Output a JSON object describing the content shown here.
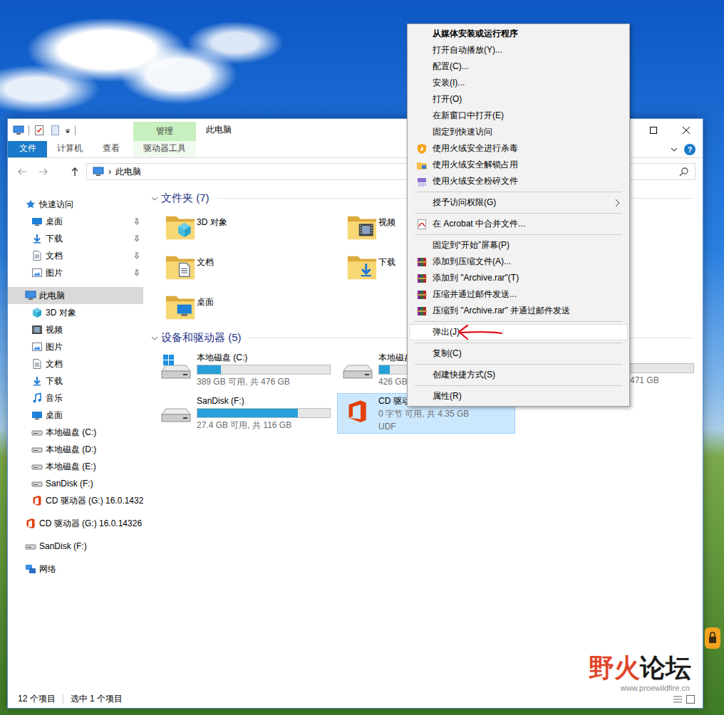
{
  "window": {
    "title": "此电脑",
    "context_tab": "管理",
    "help": "?"
  },
  "ribbon_tabs": [
    {
      "label": "文件",
      "selected": false,
      "kind": "file"
    },
    {
      "label": "计算机",
      "selected": false,
      "kind": "normal"
    },
    {
      "label": "查看",
      "selected": false,
      "kind": "normal"
    },
    {
      "label": "驱动器工具",
      "selected": false,
      "kind": "context"
    }
  ],
  "address": {
    "separator": "›",
    "path": "此电脑"
  },
  "nav": {
    "groups": [
      [
        {
          "label": "快速访问",
          "kind": "star",
          "child": false,
          "pinned": false,
          "selected": false
        },
        {
          "label": "桌面",
          "kind": "desktop",
          "child": true,
          "pinned": true,
          "selected": false
        },
        {
          "label": "下载",
          "kind": "download",
          "child": true,
          "pinned": true,
          "selected": false
        },
        {
          "label": "文档",
          "kind": "document",
          "child": true,
          "pinned": true,
          "selected": false
        },
        {
          "label": "图片",
          "kind": "picture",
          "child": true,
          "pinned": true,
          "selected": false
        }
      ],
      [
        {
          "label": "此电脑",
          "kind": "pc",
          "child": false,
          "pinned": false,
          "selected": true
        },
        {
          "label": "3D 对象",
          "kind": "cube",
          "child": true,
          "pinned": false,
          "selected": false
        },
        {
          "label": "视频",
          "kind": "video",
          "child": true,
          "pinned": false,
          "selected": false
        },
        {
          "label": "图片",
          "kind": "picture",
          "child": true,
          "pinned": false,
          "selected": false
        },
        {
          "label": "文档",
          "kind": "document",
          "child": true,
          "pinned": false,
          "selected": false
        },
        {
          "label": "下载",
          "kind": "download",
          "child": true,
          "pinned": false,
          "selected": false
        },
        {
          "label": "音乐",
          "kind": "music",
          "child": true,
          "pinned": false,
          "selected": false
        },
        {
          "label": "桌面",
          "kind": "desktop",
          "child": true,
          "pinned": false,
          "selected": false
        },
        {
          "label": "本地磁盘 (C:)",
          "kind": "disk",
          "child": true,
          "pinned": false,
          "selected": false
        },
        {
          "label": "本地磁盘 (D:)",
          "kind": "disk",
          "child": true,
          "pinned": false,
          "selected": false
        },
        {
          "label": "本地磁盘 (E:)",
          "kind": "disk",
          "child": true,
          "pinned": false,
          "selected": false
        },
        {
          "label": "SanDisk (F:)",
          "kind": "disk",
          "child": true,
          "pinned": false,
          "selected": false
        },
        {
          "label": "CD 驱动器 (G:) 16.0.1432",
          "kind": "office",
          "child": true,
          "pinned": false,
          "selected": false
        }
      ],
      [
        {
          "label": "CD 驱动器 (G:) 16.0.14326",
          "kind": "office",
          "child": false,
          "pinned": false,
          "selected": false
        }
      ],
      [
        {
          "label": "SanDisk (F:)",
          "kind": "disk",
          "child": false,
          "pinned": false,
          "selected": false
        }
      ],
      [
        {
          "label": "网络",
          "kind": "network",
          "child": false,
          "pinned": false,
          "selected": false
        }
      ]
    ]
  },
  "folders": {
    "title": "文件夹 (7)",
    "expanded": true,
    "items": [
      {
        "name": "3D 对象",
        "kind": "cube"
      },
      {
        "name": "视频",
        "kind": "video"
      },
      {
        "name": "文档",
        "kind": "document"
      },
      {
        "name": "下载",
        "kind": "download"
      },
      {
        "name": "桌面",
        "kind": "desktop"
      }
    ]
  },
  "drives": {
    "title": "设备和驱动器 (5)",
    "expanded": true,
    "items": [
      {
        "name": "本地磁盘 (C:)",
        "info": "389 GB 可用, 共 476 GB",
        "level": 0.18,
        "kind": "windows",
        "selected": false
      },
      {
        "name": "本地磁盘",
        "info": "426 GB",
        "level": 0.08,
        "kind": "disk",
        "selected": false
      },
      {
        "name": "",
        "info": "471 GB",
        "level": 0.3,
        "kind": "covered",
        "selected": false
      },
      {
        "name": "SanDisk (F:)",
        "info": "27.4 GB 可用, 共 116 GB",
        "level": 0.76,
        "kind": "disk",
        "selected": false
      },
      {
        "name": "CD 驱动",
        "info": "0 字节 可用, 共 4.35 GB",
        "fs": "UDF",
        "kind": "office",
        "selected": true
      }
    ]
  },
  "status_bar": {
    "count": "12 个项目",
    "selection": "选中 1 个项目"
  },
  "context_menu": {
    "groups": [
      [
        {
          "label": "从媒体安装或运行程序",
          "kind": "default",
          "selected": false
        },
        {
          "label": "打开自动播放(Y)...",
          "kind": "plain",
          "selected": false
        },
        {
          "label": "配置(C)...",
          "kind": "plain",
          "selected": false
        },
        {
          "label": "安装(I)...",
          "kind": "plain",
          "selected": false
        },
        {
          "label": "打开(O)",
          "kind": "plain",
          "selected": false
        },
        {
          "label": "在新窗口中打开(E)",
          "kind": "plain",
          "selected": false
        },
        {
          "label": "固定到快速访问",
          "kind": "plain",
          "selected": false
        },
        {
          "label": "使用火绒安全进行杀毒",
          "kind": "huorong",
          "selected": false
        },
        {
          "label": "使用火绒安全解锁占用",
          "kind": "unlock",
          "selected": false
        },
        {
          "label": "使用火绒安全粉碎文件",
          "kind": "shred",
          "selected": false
        }
      ],
      [
        {
          "label": "授予访问权限(G)",
          "kind": "submenu",
          "selected": false
        }
      ],
      [
        {
          "label": "在 Acrobat 中合并文件...",
          "kind": "acrobat",
          "selected": false
        }
      ],
      [
        {
          "label": "固定到“开始”屏幕(P)",
          "kind": "plain",
          "selected": false
        },
        {
          "label": "添加到压缩文件(A)...",
          "kind": "winrar",
          "selected": false
        },
        {
          "label": "添加到 \"Archive.rar\"(T)",
          "kind": "winrar",
          "selected": false
        },
        {
          "label": "压缩并通过邮件发送...",
          "kind": "winrar",
          "selected": false
        },
        {
          "label": "压缩到 \"Archive.rar\" 并通过邮件发送",
          "kind": "winrar",
          "selected": false
        }
      ],
      [
        {
          "label": "弹出(J)",
          "kind": "plain",
          "selected": true
        }
      ],
      [
        {
          "label": "复制(C)",
          "kind": "plain",
          "selected": false
        }
      ],
      [
        {
          "label": "创建快捷方式(S)",
          "kind": "plain",
          "selected": false
        }
      ],
      [
        {
          "label": "属性(R)",
          "kind": "plain",
          "selected": false
        }
      ]
    ]
  },
  "watermark": {
    "brand_primary": "野火",
    "brand_secondary": "论坛",
    "url": "www.proewildfire.cn"
  }
}
